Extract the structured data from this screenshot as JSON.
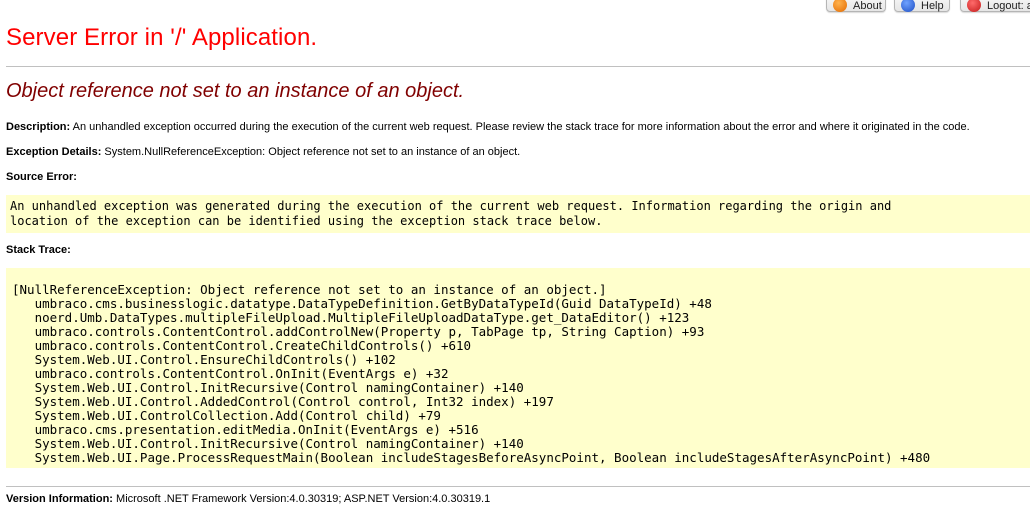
{
  "toolbar": {
    "about_label": "About",
    "help_label": "Help",
    "logout_label": "Logout: a"
  },
  "page": {
    "title": "Server Error in '/' Application.",
    "error_message": "Object reference not set to an instance of an object.",
    "description_label": "Description:",
    "description_text": "An unhandled exception occurred during the execution of the current web request. Please review the stack trace for more information about the error and where it originated in the code.",
    "exception_label": "Exception Details:",
    "exception_text": "System.NullReferenceException: Object reference not set to an instance of an object.",
    "source_error_label": "Source Error:",
    "source_error_lines": [
      "An unhandled exception was generated during the execution of the current web request. Information regarding the origin and",
      "location of the exception can be identified using the exception stack trace below."
    ],
    "stack_trace_label": "Stack Trace:",
    "stack_trace_lines": [
      "[NullReferenceException: Object reference not set to an instance of an object.]",
      "   umbraco.cms.businesslogic.datatype.DataTypeDefinition.GetByDataTypeId(Guid DataTypeId) +48",
      "   noerd.Umb.DataTypes.multipleFileUpload.MultipleFileUploadDataType.get_DataEditor() +123",
      "   umbraco.controls.ContentControl.addControlNew(Property p, TabPage tp, String Caption) +93",
      "   umbraco.controls.ContentControl.CreateChildControls() +610",
      "   System.Web.UI.Control.EnsureChildControls() +102",
      "   umbraco.controls.ContentControl.OnInit(EventArgs e) +32",
      "   System.Web.UI.Control.InitRecursive(Control namingContainer) +140",
      "   System.Web.UI.Control.AddedControl(Control control, Int32 index) +197",
      "   System.Web.UI.ControlCollection.Add(Control child) +79",
      "   umbraco.cms.presentation.editMedia.OnInit(EventArgs e) +516",
      "   System.Web.UI.Control.InitRecursive(Control namingContainer) +140",
      "   System.Web.UI.Page.ProcessRequestMain(Boolean includeStagesBeforeAsyncPoint, Boolean includeStagesAfterAsyncPoint) +480"
    ],
    "version_label": "Version Information:",
    "version_text": "Microsoft .NET Framework Version:4.0.30319; ASP.NET Version:4.0.30319.1"
  }
}
